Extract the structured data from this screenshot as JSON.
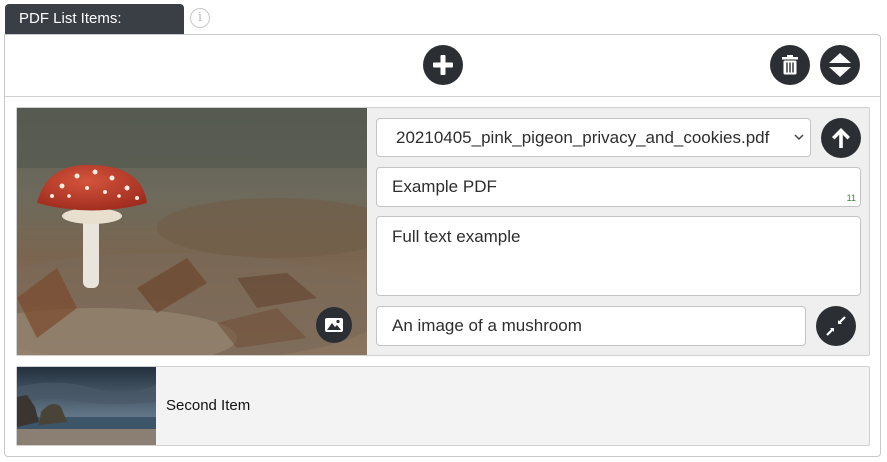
{
  "header": {
    "tab_label": "PDF List Items:",
    "info_glyph": "i"
  },
  "toolbar": {
    "add_icon": "plus-icon",
    "delete_icon": "trash-icon",
    "sort_icon": "sort-icon"
  },
  "items": [
    {
      "image_description_icon": "image-icon",
      "pdf_select": {
        "selected": "20210405_pink_pigeon_privacy_and_cookies.pdf"
      },
      "title": "Example PDF",
      "title_counter": "11",
      "full_text": "Full text example",
      "alt_text": "An image of a mushroom",
      "upload_icon": "arrow-up-icon",
      "collapse_icon": "compress-icon"
    },
    {
      "label": "Second Item"
    }
  ],
  "colors": {
    "tab_bg": "#3a3f46",
    "button_bg": "#2b2f33",
    "item_bg": "#efefef",
    "counter_green": "#3a8a3a"
  }
}
